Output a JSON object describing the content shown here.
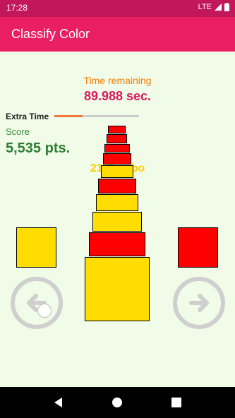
{
  "status_bar": {
    "time": "17:28",
    "network": "LTE"
  },
  "app_bar": {
    "title": "Classify Color"
  },
  "timer": {
    "label": "Time remaining",
    "value": "89.988 sec."
  },
  "extra_time": {
    "label": "Extra Time",
    "progress": 0.33
  },
  "score": {
    "label": "Score",
    "value": "5,535 pts."
  },
  "combo": {
    "text": "21 Combo"
  },
  "samples": {
    "left_color": "#ffdd00",
    "right_color": "#ff0000"
  },
  "stack": [
    {
      "color": "#ff0000"
    },
    {
      "color": "#ff0000"
    },
    {
      "color": "#ff0000"
    },
    {
      "color": "#ff0000"
    },
    {
      "color": "#ffdd00"
    },
    {
      "color": "#ff0000"
    },
    {
      "color": "#ffdd00"
    },
    {
      "color": "#ffdd00"
    },
    {
      "color": "#ff0000"
    },
    {
      "color": "#ffdd00"
    }
  ],
  "controls": {
    "left_icon": "arrow-left-icon",
    "right_icon": "arrow-right-icon"
  },
  "nav": {
    "back_icon": "back-triangle-icon",
    "home_icon": "home-circle-icon",
    "recents_icon": "recents-square-icon"
  },
  "colors": {
    "accent": "#e91e63",
    "status_bar": "#c2185b",
    "background": "#f0fbe8"
  }
}
